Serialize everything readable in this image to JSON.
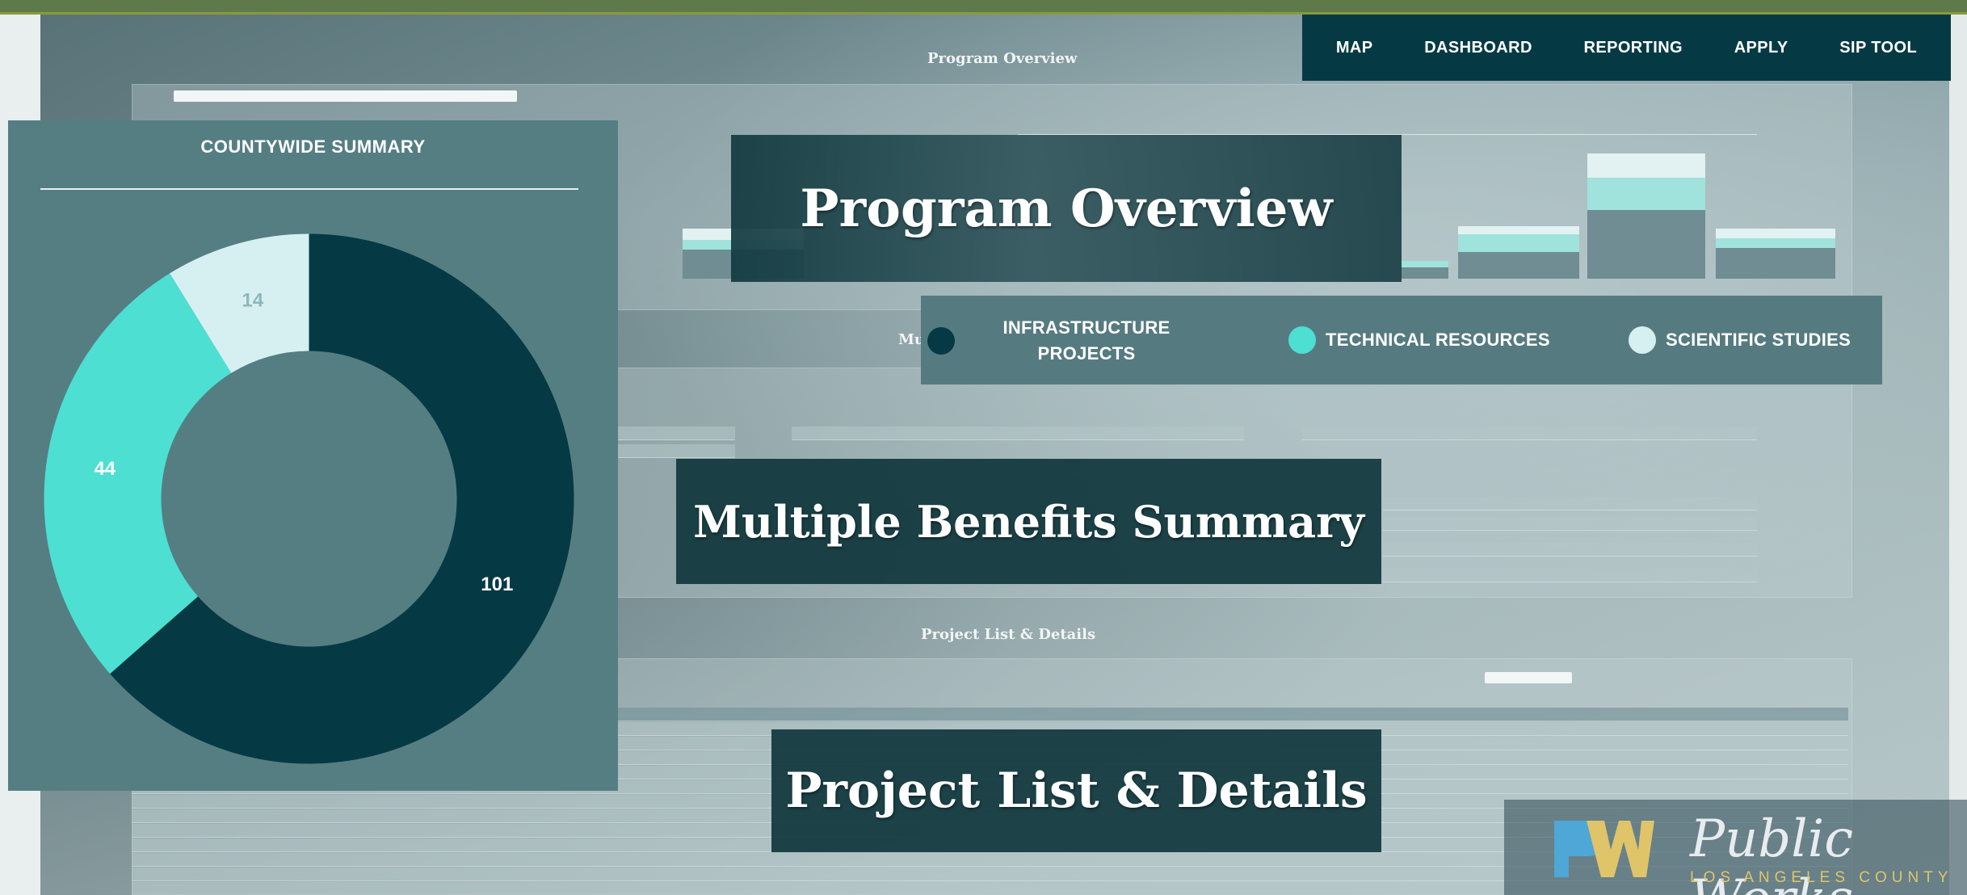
{
  "nav": {
    "items": [
      "MAP",
      "DASHBOARD",
      "REPORTING",
      "APPLY",
      "SIP TOOL"
    ]
  },
  "countywide_summary": {
    "title": "COUNTYWIDE SUMMARY"
  },
  "chart_data": {
    "type": "pie",
    "title": "COUNTYWIDE SUMMARY",
    "donut": true,
    "categories": [
      "INFRASTRUCTURE PROJECTS",
      "TECHNICAL RESOURCES",
      "SCIENTIFIC STUDIES"
    ],
    "values": [
      101,
      44,
      14
    ],
    "colors": [
      "#053a45",
      "#4ddfd2",
      "#d6f0f2"
    ],
    "data_labels": [
      "101",
      "44",
      "14"
    ]
  },
  "legend": {
    "items": [
      {
        "label": "INFRASTRUCTURE PROJECTS",
        "color": "#053a45"
      },
      {
        "label": "TECHNICAL RESOURCES",
        "color": "#4ddfd2"
      },
      {
        "label": "SCIENTIFIC STUDIES",
        "color": "#d6f0f2"
      }
    ]
  },
  "overlays": {
    "program_overview": "Program Overview",
    "multiple_benefits": "Multiple Benefits Summary",
    "project_list": "Project List & Details"
  },
  "background": {
    "program_overview_heading": "Program Overview",
    "project_list_heading": "Project List & Details",
    "benefits_heading_partial": "Mu"
  },
  "logo": {
    "name": "Public Works",
    "subtitle": "LOS ANGELES COUNTY",
    "colors": {
      "p": "#4ea7d6",
      "w": "#e0c46a"
    }
  }
}
